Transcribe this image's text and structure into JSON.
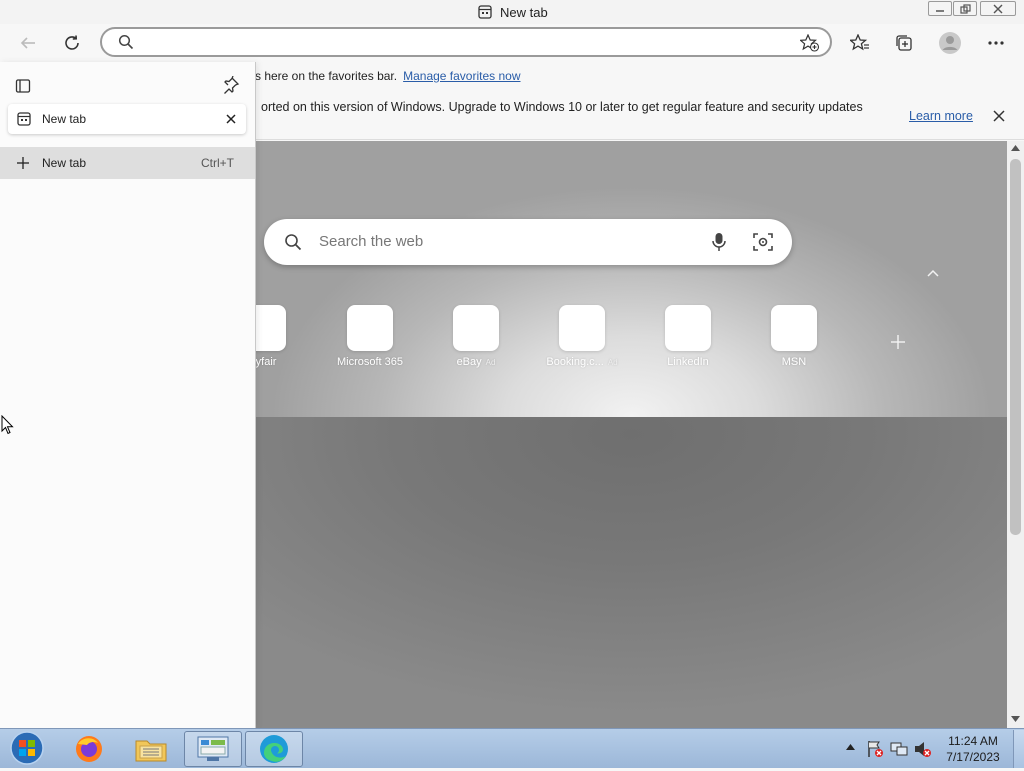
{
  "window": {
    "title": "New tab"
  },
  "toolbar": {
    "address_value": "",
    "address_placeholder": ""
  },
  "favorites_bar": {
    "text": "s here on the favorites bar.",
    "link": "Manage favorites now"
  },
  "update_bar": {
    "text": "orted on this version of Windows. Upgrade to Windows 10 or later to get regular feature and security updates",
    "link": "Learn more"
  },
  "sidebar": {
    "tabs": [
      {
        "label": "New tab"
      }
    ],
    "new_tab_label": "New tab",
    "new_tab_shortcut": "Ctrl+T"
  },
  "new_tab_page": {
    "search_placeholder": "Search the web",
    "quick_links": [
      {
        "label": "ayfair",
        "ad": false
      },
      {
        "label": "Microsoft 365",
        "ad": false
      },
      {
        "label": "eBay",
        "ad": true
      },
      {
        "label": "Booking.c...",
        "ad": true
      },
      {
        "label": "LinkedIn",
        "ad": false
      },
      {
        "label": "MSN",
        "ad": false
      }
    ],
    "ad_label": "Ad",
    "add_tile_icon": "plus-icon"
  },
  "taskbar": {
    "apps": [
      "start-orb",
      "firefox",
      "file-explorer",
      "control-panel",
      "edge"
    ],
    "time": "11:24 AM",
    "date": "7/17/2023"
  },
  "colors": {
    "link": "#2a5da8",
    "taskbar": "#a9c3e2"
  }
}
